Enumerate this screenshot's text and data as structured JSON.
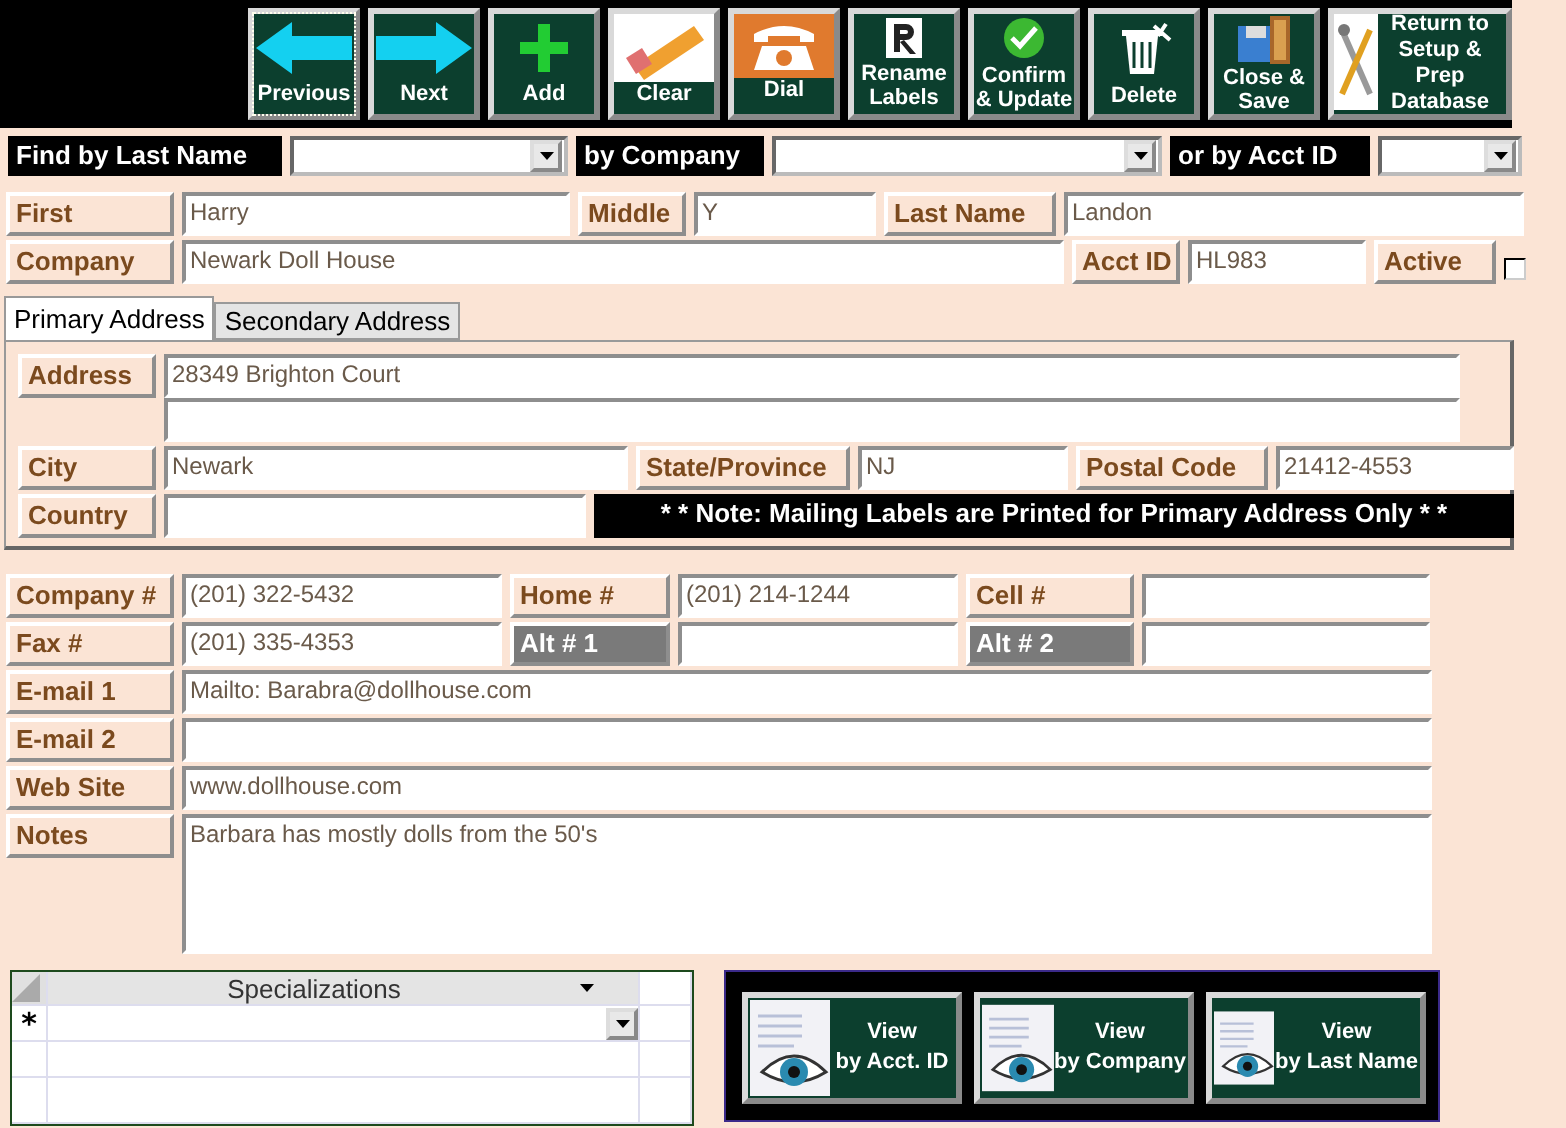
{
  "toolbar": {
    "buttons": [
      {
        "kind": "previous",
        "label": "Previous",
        "focused": true
      },
      {
        "kind": "next",
        "label": "Next",
        "focused": false
      },
      {
        "kind": "add",
        "label": "Add",
        "focused": false
      },
      {
        "kind": "clear",
        "label": "Clear",
        "focused": false
      },
      {
        "kind": "dial",
        "label": "Dial",
        "focused": false
      },
      {
        "kind": "rename",
        "label": "Rename Labels",
        "focused": false
      },
      {
        "kind": "confirm",
        "label": "Confirm & Update",
        "focused": false
      },
      {
        "kind": "delete",
        "label": "Delete",
        "focused": false
      },
      {
        "kind": "close",
        "label": "Close & Save",
        "focused": false
      },
      {
        "kind": "setup",
        "label": "Return to Setup & Prep Database",
        "focused": false
      }
    ]
  },
  "find": [
    {
      "label": "Find by Last Name"
    },
    {
      "label": "by Company"
    },
    {
      "label": "or by Acct ID"
    }
  ],
  "contact_rows": [
    [
      {
        "label": "First",
        "value": "Harry"
      },
      {
        "label": "Middle",
        "value": "Y"
      },
      {
        "label": "Last Name",
        "value": "Landon"
      }
    ],
    [
      {
        "label": "Company",
        "value": "Newark Doll House"
      },
      {
        "label": "Acct ID",
        "value": "HL983"
      },
      {
        "label": "Active",
        "kind": "checkbox",
        "checked": false
      }
    ]
  ],
  "tabs": [
    {
      "label": "Primary Address",
      "selected": true
    },
    {
      "label": "Secondary Address",
      "selected": false
    }
  ],
  "address": {
    "label": "Address",
    "line_1": "28349 Brighton Court",
    "city_label": "City",
    "city": "Newark",
    "state_label": "State/Province",
    "state": "NJ",
    "postal_label": "Postal Code",
    "postal": "21412-4553",
    "country_label": "Country",
    "note": "* * Note: Mailing Labels are Printed for Primary Address Only * *"
  },
  "phone_rows": [
    [
      {
        "label": "Company #",
        "value": "(201) 322-5432",
        "disabled": false
      },
      {
        "label": "Home #",
        "value": "(201) 214-1244",
        "disabled": false
      },
      {
        "label": "Cell #",
        "disabled": false
      }
    ],
    [
      {
        "label": "Fax #",
        "value": "(201) 335-4353",
        "disabled": false
      },
      {
        "label": "Alt # 1",
        "disabled": true
      },
      {
        "label": "Alt # 2",
        "disabled": true
      }
    ]
  ],
  "detail_rows": [
    {
      "label": "E-mail 1",
      "value": "Mailto: Barabra@dollhouse.com"
    },
    {
      "label": "E-mail 2"
    },
    {
      "label": "Web Site",
      "value": "www.dollhouse.com"
    },
    {
      "label": "Notes",
      "value": "Barbara has mostly dolls from the 50's",
      "kind": "memo"
    }
  ],
  "specializations": {
    "column": "Specializations",
    "new_row_marker": "*"
  },
  "view_buttons": [
    {
      "line_1": "View",
      "line_2": "by Acct. ID"
    },
    {
      "line_1": "View",
      "line_2": "by Company"
    },
    {
      "line_1": "View",
      "line_2": "by Last Name"
    }
  ]
}
